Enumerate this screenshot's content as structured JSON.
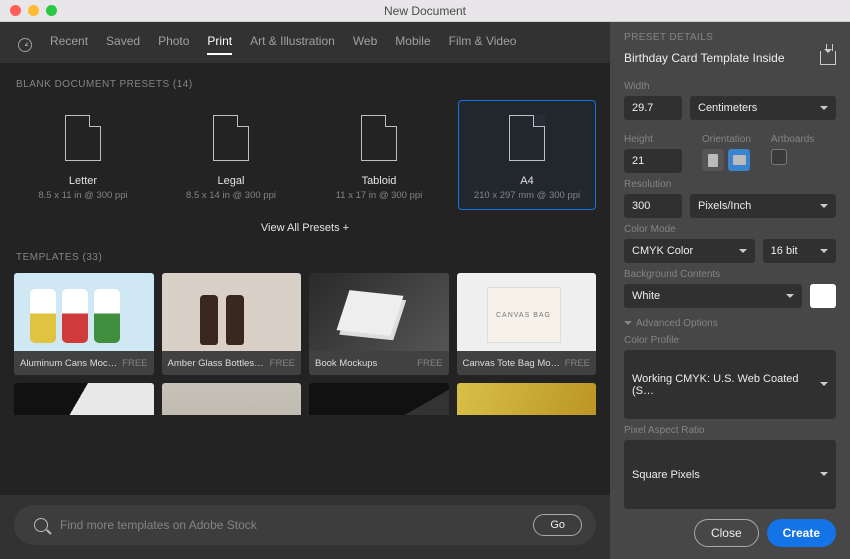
{
  "window": {
    "title": "New Document"
  },
  "tabs": {
    "items": [
      "Recent",
      "Saved",
      "Photo",
      "Print",
      "Art & Illustration",
      "Web",
      "Mobile",
      "Film & Video"
    ],
    "active": "Print"
  },
  "presets_section": {
    "title": "BLANK DOCUMENT PRESETS  (14)",
    "view_all": "View All Presets +"
  },
  "presets": [
    {
      "name": "Letter",
      "spec": "8.5 x 11 in @ 300 ppi"
    },
    {
      "name": "Legal",
      "spec": "8.5 x 14 in @ 300 ppi"
    },
    {
      "name": "Tabloid",
      "spec": "11 x 17 in @ 300 ppi"
    },
    {
      "name": "A4",
      "spec": "210 x 297 mm @ 300 ppi",
      "selected": true
    }
  ],
  "templates_section": {
    "title": "TEMPLATES  (33)"
  },
  "templates": [
    {
      "name": "Aluminum Cans Moc…",
      "price": "FREE",
      "thumb": "cans"
    },
    {
      "name": "Amber Glass Bottles…",
      "price": "FREE",
      "thumb": "bottles"
    },
    {
      "name": "Book Mockups",
      "price": "FREE",
      "thumb": "books"
    },
    {
      "name": "Canvas Tote Bag Mo…",
      "price": "FREE",
      "thumb": "tote"
    }
  ],
  "search": {
    "placeholder": "Find more templates on Adobe Stock",
    "go": "Go"
  },
  "details": {
    "header": "PRESET DETAILS",
    "doc_name": "Birthday Card Template Inside",
    "width_label": "Width",
    "width_value": "29.7",
    "width_unit": "Centimeters",
    "height_label": "Height",
    "height_value": "21",
    "orientation_label": "Orientation",
    "orientation": "landscape",
    "artboards_label": "Artboards",
    "resolution_label": "Resolution",
    "resolution_value": "300",
    "resolution_unit": "Pixels/Inch",
    "color_mode_label": "Color Mode",
    "color_mode": "CMYK Color",
    "color_depth": "16 bit",
    "bg_label": "Background Contents",
    "bg_value": "White",
    "bg_color": "#ffffff",
    "advanced_label": "Advanced Options",
    "profile_label": "Color Profile",
    "profile_value": "Working CMYK: U.S. Web Coated (S…",
    "aspect_label": "Pixel Aspect Ratio",
    "aspect_value": "Square Pixels"
  },
  "footer": {
    "close": "Close",
    "create": "Create"
  }
}
